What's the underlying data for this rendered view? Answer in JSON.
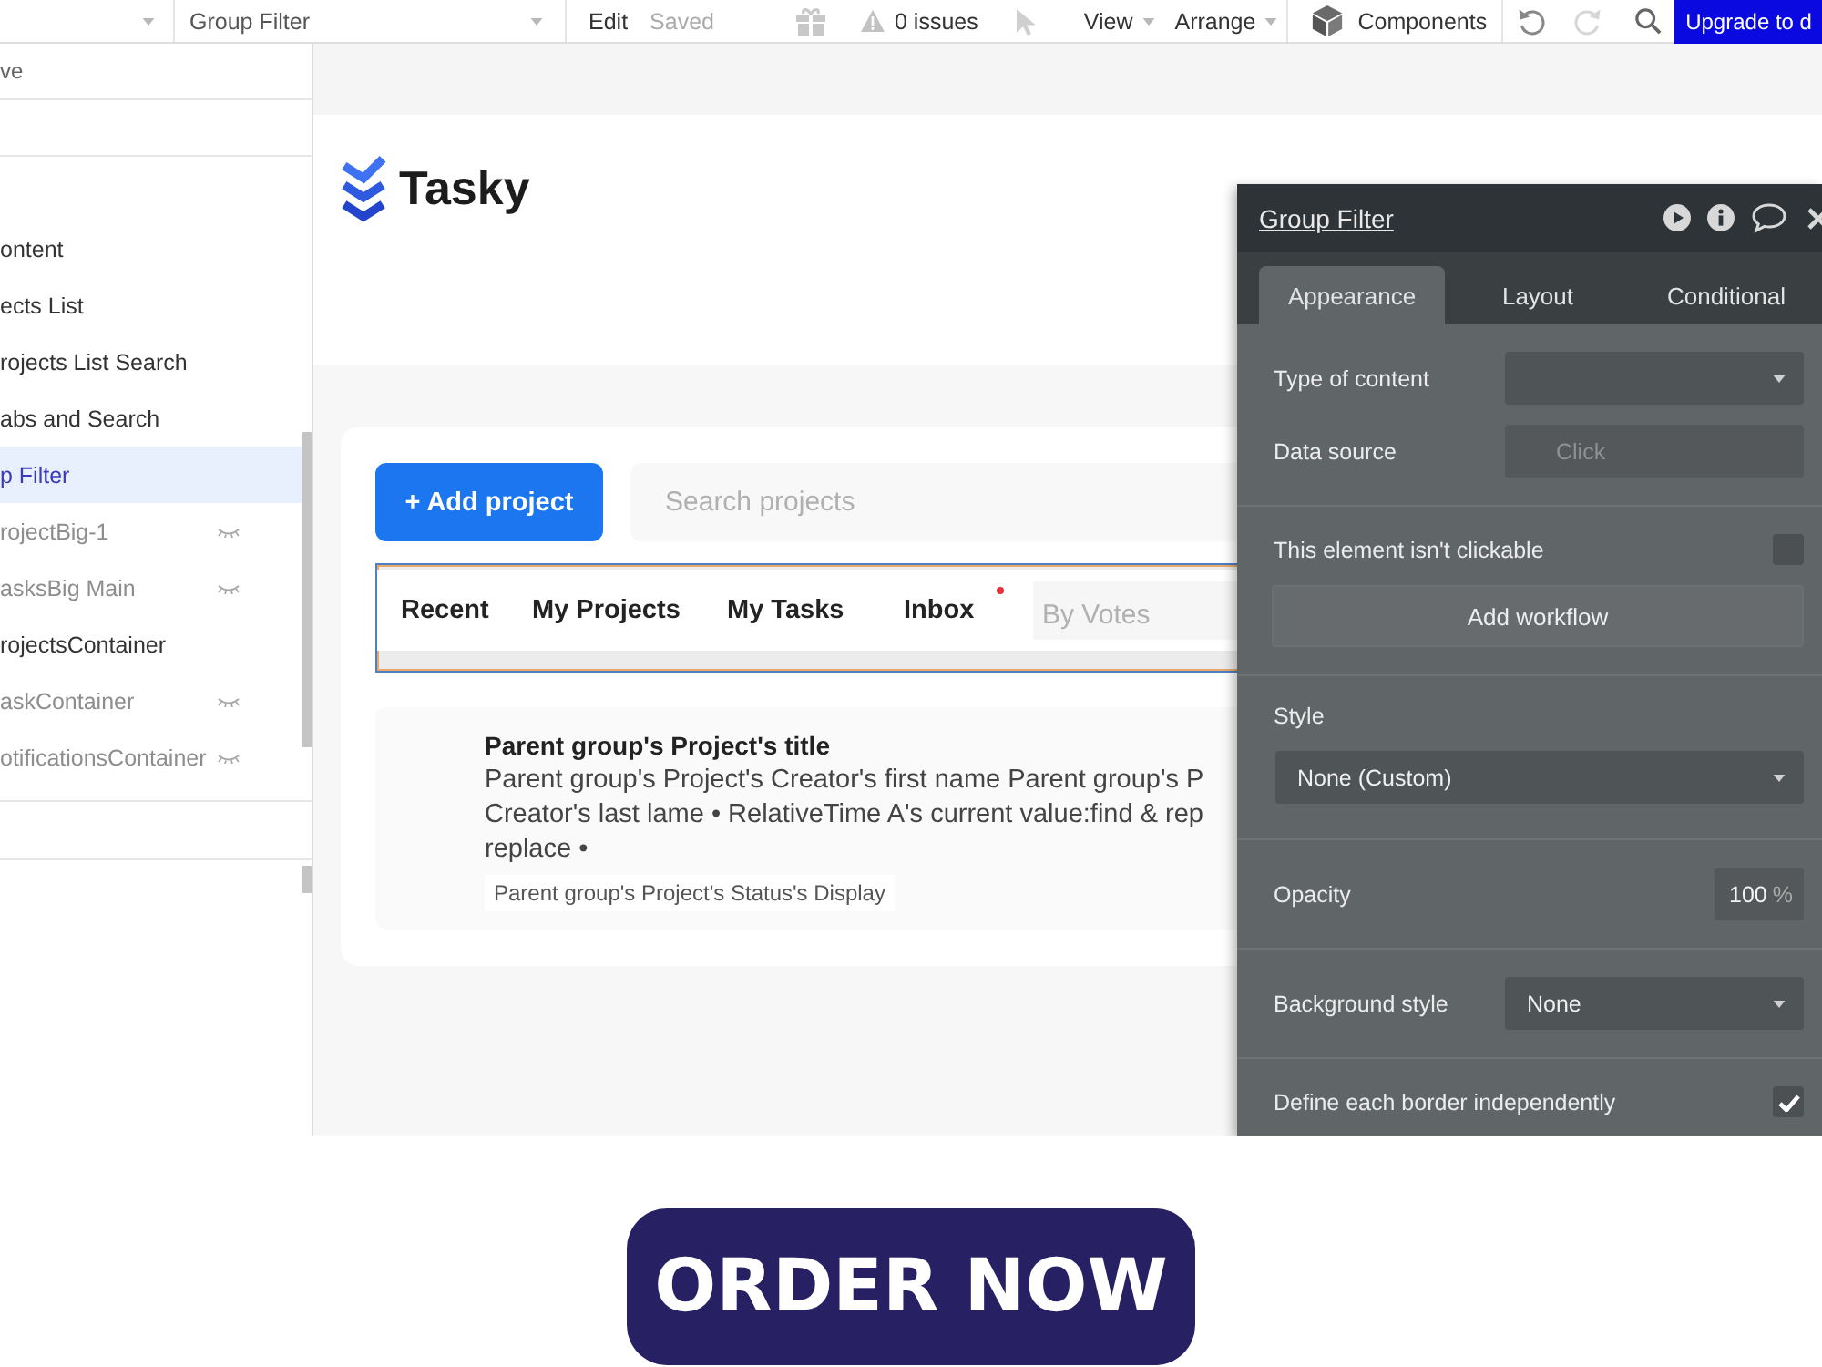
{
  "toolbar": {
    "element_dropdown": "Group Filter",
    "edit_menu": "Edit",
    "save_status": "Saved",
    "issues": "0 issues",
    "menus": [
      "View",
      "Arrange"
    ],
    "components": "Components",
    "undo": {
      "disabled": false
    },
    "redo": {
      "disabled": true
    },
    "upgrade_button": "Upgrade to d"
  },
  "sidebar": {
    "option_text": "ve",
    "elements": [
      {
        "label": "ontent",
        "hidden": false,
        "selected": false
      },
      {
        "label": "ects List",
        "hidden": false,
        "selected": false
      },
      {
        "label": "rojects List Search",
        "hidden": false,
        "selected": false
      },
      {
        "label": "abs and Search",
        "hidden": false,
        "selected": false
      },
      {
        "label": "p Filter",
        "hidden": false,
        "selected": true
      },
      {
        "label": "rojectBig-1",
        "hidden": true,
        "selected": false
      },
      {
        "label": "asksBig Main",
        "hidden": true,
        "selected": false
      },
      {
        "label": "rojectsContainer",
        "hidden": false,
        "selected": false
      },
      {
        "label": "askContainer",
        "hidden": true,
        "selected": false
      },
      {
        "label": "otificationsContainer",
        "hidden": true,
        "selected": false
      }
    ]
  },
  "canvas": {
    "logo": "Tasky",
    "add_button": "+ Add project",
    "search": {
      "placeholder": "Search projects"
    },
    "tabs": [
      {
        "label": "Recent",
        "dot": false
      },
      {
        "label": "My Projects",
        "dot": false
      },
      {
        "label": "My Tasks",
        "dot": false
      },
      {
        "label": "Inbox",
        "dot": true
      }
    ],
    "sort": {
      "placeholder": "By Votes"
    },
    "project": {
      "title": "Parent group's Project's title",
      "description_lines": [
        "Parent group's Project's Creator's first name Parent group's P",
        "Creator's last lame • RelativeTime A's current value:find & rep",
        "replace •"
      ],
      "status": "Parent group's Project's Status's Display"
    }
  },
  "panel": {
    "title": "Group Filter",
    "tabs": [
      {
        "label": "Appearance",
        "selected": true
      },
      {
        "label": "Layout",
        "selected": false
      },
      {
        "label": "Conditional",
        "selected": false
      }
    ],
    "sections": [
      {
        "rows": [
          {
            "kind": "select",
            "label": "Type of content"
          },
          {
            "kind": "text",
            "label": "Data source",
            "placeholder": "Click"
          }
        ]
      },
      {
        "rows": [
          {
            "kind": "checkbox",
            "label": "This element isn't clickable",
            "checked": false
          },
          {
            "kind": "button",
            "label": "Add workflow"
          }
        ]
      },
      {
        "rows": [
          {
            "kind": "select_stacked",
            "label": "Style",
            "value": "None (Custom)"
          }
        ]
      },
      {
        "rows": [
          {
            "kind": "number",
            "label": "Opacity",
            "value": "100",
            "unit": "%"
          }
        ]
      },
      {
        "rows": [
          {
            "kind": "select",
            "label": "Background style",
            "value": "None"
          }
        ]
      },
      {
        "rows": [
          {
            "kind": "checkbox",
            "label": "Define each border independently",
            "checked": true
          }
        ]
      }
    ]
  },
  "cta": {
    "label": "ORDER NOW"
  }
}
